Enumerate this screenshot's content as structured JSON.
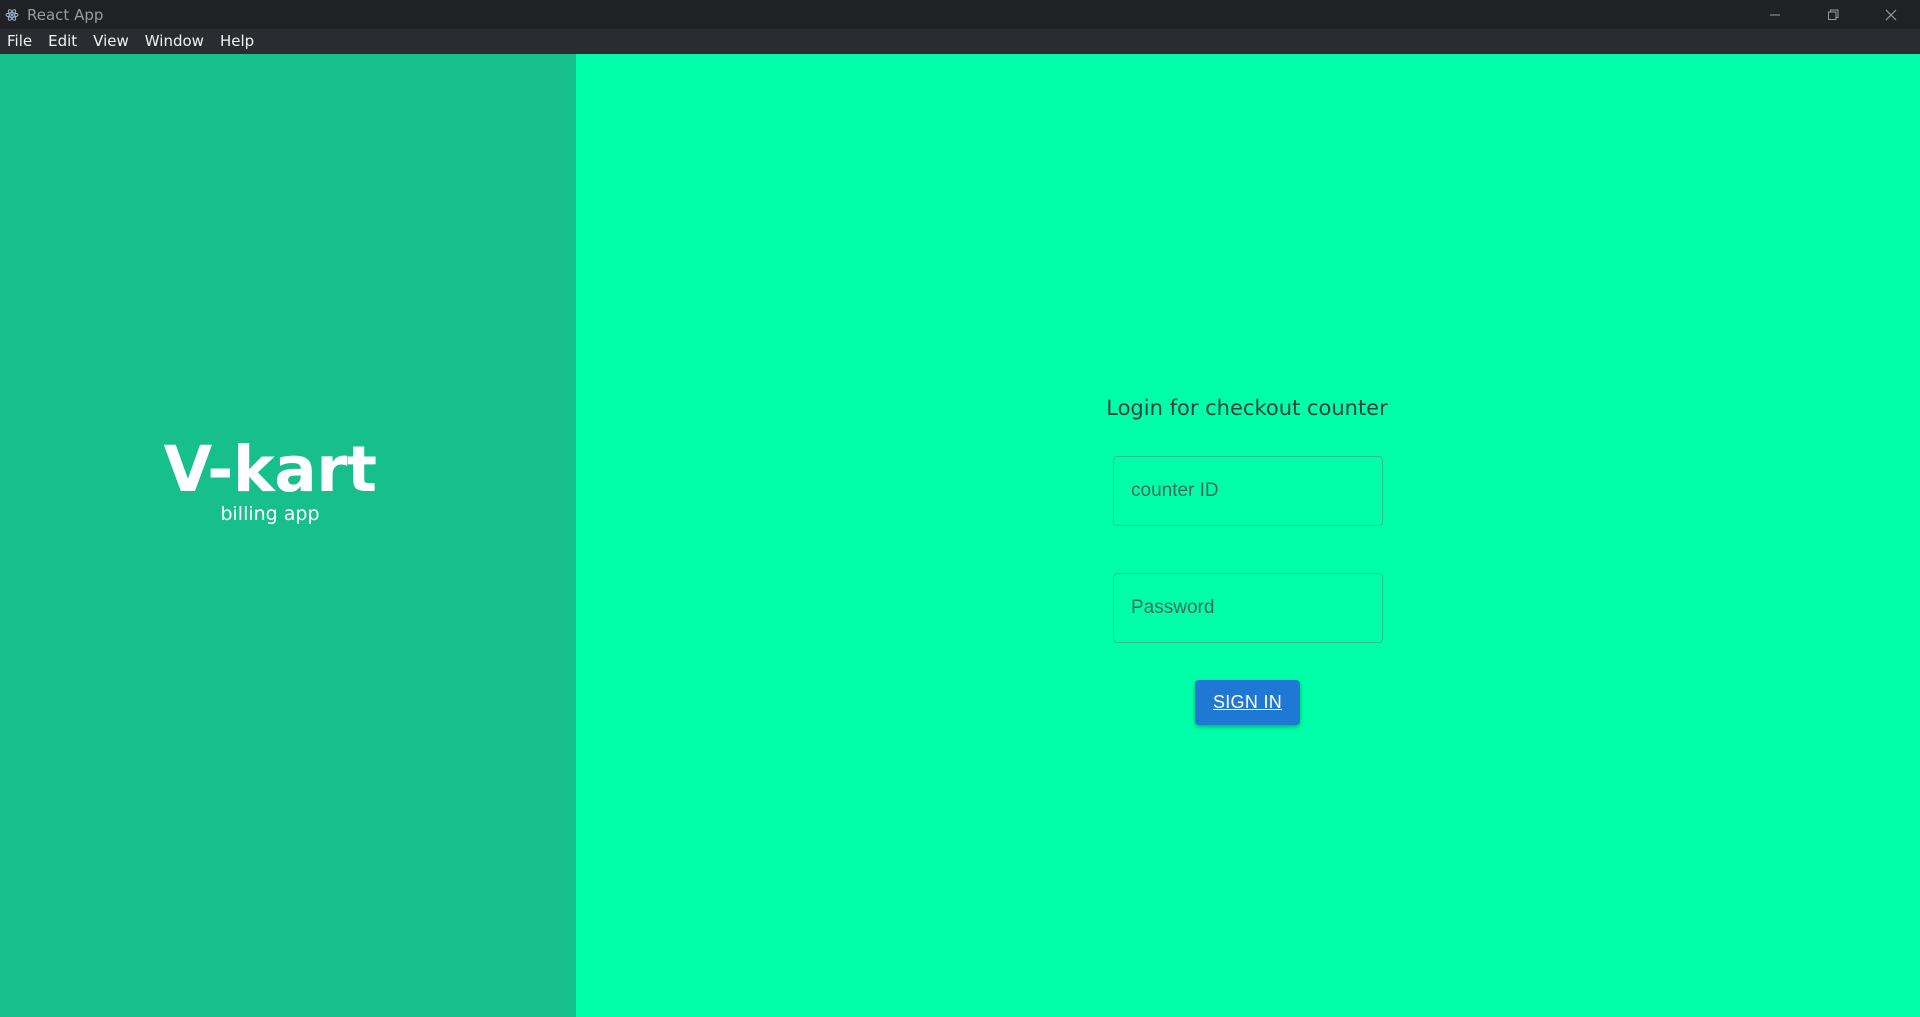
{
  "window": {
    "title": "React App",
    "icon": "electron-atom-icon",
    "controls": [
      "minimize-icon",
      "restore-icon",
      "close-icon"
    ]
  },
  "menu": [
    "File",
    "Edit",
    "View",
    "Window",
    "Help"
  ],
  "brand": {
    "name": "V-kart",
    "tagline": "billing app"
  },
  "login": {
    "heading": "Login for checkout counter",
    "counter_placeholder": "counter ID",
    "counter_value": "",
    "password_placeholder": "Password",
    "password_value": "",
    "signin_label": "SIGN IN"
  },
  "colors": {
    "left_panel": "#16bf8b",
    "right_panel": "#00ffa9",
    "button": "#1e78d4"
  }
}
